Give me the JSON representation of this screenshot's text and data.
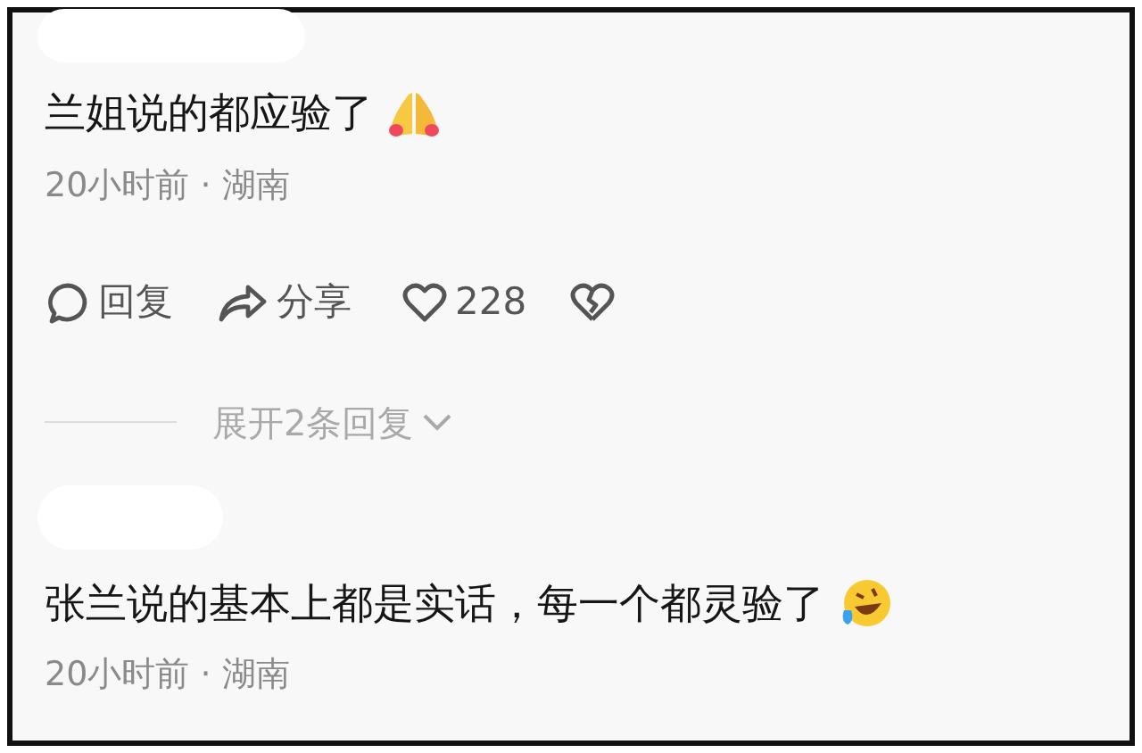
{
  "comments": [
    {
      "text": "兰姐说的都应验了",
      "emoji": {
        "kind": "pray"
      },
      "meta": "20小时前 · 湖南",
      "actions": {
        "reply": "回复",
        "share": "分享",
        "likes": "228"
      },
      "expand": "展开2条回复"
    },
    {
      "text": "张兰说的基本上都是实话，每一个都灵验了",
      "emoji": {
        "kind": "laugh"
      },
      "meta": "20小时前 · 湖南"
    }
  ]
}
